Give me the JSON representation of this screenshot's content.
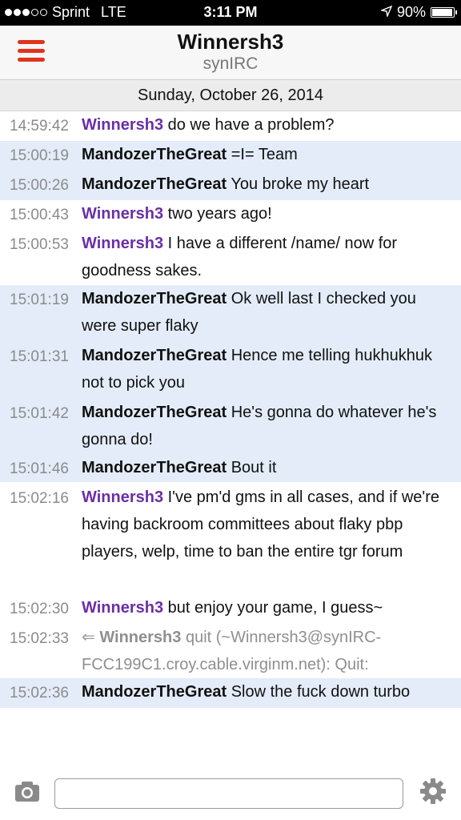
{
  "status_bar": {
    "carrier": "Sprint",
    "network": "LTE",
    "time": "3:11 PM",
    "battery": "90%",
    "battery_level": 0.9,
    "signal_bars_filled": 3,
    "signal_bars_total": 5
  },
  "header": {
    "title": "Winnersh3",
    "subtitle": "synIRC",
    "menu_icon": "hamburger-menu-icon",
    "accent_color": "#e0341d"
  },
  "date": "Sunday, October 26, 2014",
  "colors": {
    "highlight_bg": "#e3ecf8",
    "own_nick": "#6a2fa5",
    "timestamp": "#8b8b8b"
  },
  "messages": [
    {
      "time": "14:59:42",
      "nick": "Winnersh3",
      "text": "do we have a problem?"
    },
    {
      "time": "15:00:19",
      "nick": "MandozerTheGreat",
      "text": "=I= Team"
    },
    {
      "time": "15:00:26",
      "nick": "MandozerTheGreat",
      "text": "You broke my heart"
    },
    {
      "time": "15:00:43",
      "nick": "Winnersh3",
      "text": "two years ago!"
    },
    {
      "time": "15:00:53",
      "nick": "Winnersh3",
      "text": "I have a different /name/ now for goodness sakes."
    },
    {
      "time": "15:01:19",
      "nick": "MandozerTheGreat",
      "text": "Ok well last I checked you were super flaky"
    },
    {
      "time": "15:01:31",
      "nick": "MandozerTheGreat",
      "text": "Hence me telling hukhukhuk not to pick you"
    },
    {
      "time": "15:01:42",
      "nick": "MandozerTheGreat",
      "text": "He's gonna do whatever he's gonna do!"
    },
    {
      "time": "15:01:46",
      "nick": "MandozerTheGreat",
      "text": "Bout it"
    },
    {
      "time": "15:02:16",
      "nick": "Winnersh3",
      "text": "I've pm'd gms in all cases, and if we're having backroom committees about flaky pbp players, welp, time to ban the entire tgr forum"
    },
    {
      "time": "15:02:30",
      "nick": "Winnersh3",
      "text": "but enjoy your game, I guess~"
    },
    {
      "time": "15:02:33",
      "arrow": "⇐",
      "nick": "Winnersh3",
      "text": "quit (~Winnersh3@synIRC-FCC199C1.croy.cable.virginm.net): Quit:"
    },
    {
      "time": "15:02:36",
      "nick": "MandozerTheGreat",
      "text": "Slow the fuck down turbo"
    }
  ],
  "input": {
    "placeholder": "",
    "value": "",
    "camera_icon": "camera-icon",
    "settings_icon": "gear-icon"
  }
}
